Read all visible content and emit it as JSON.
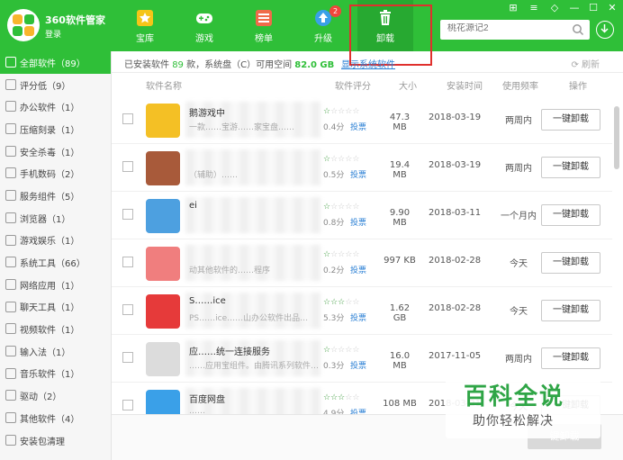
{
  "app": {
    "title": "360软件管家",
    "login": "登录"
  },
  "nav": {
    "tabs": [
      {
        "label": "宝库",
        "icon": "star-icon"
      },
      {
        "label": "游戏",
        "icon": "gamepad-icon"
      },
      {
        "label": "榜单",
        "icon": "ranking-icon"
      },
      {
        "label": "升级",
        "icon": "upgrade-arrow-icon",
        "badge": "2"
      },
      {
        "label": "卸载",
        "icon": "trash-icon"
      }
    ]
  },
  "search": {
    "placeholder": "桃花源记2"
  },
  "sidebar": {
    "items": [
      {
        "label": "全部软件（89）"
      },
      {
        "label": "评分低（9）"
      },
      {
        "label": "办公软件（1）"
      },
      {
        "label": "压缩刻录（1）"
      },
      {
        "label": "安全杀毒（1）"
      },
      {
        "label": "手机数码（2）"
      },
      {
        "label": "服务组件（5）"
      },
      {
        "label": "浏览器（1）"
      },
      {
        "label": "游戏娱乐（1）"
      },
      {
        "label": "系统工具（66）"
      },
      {
        "label": "网络应用（1）"
      },
      {
        "label": "聊天工具（1）"
      },
      {
        "label": "视频软件（1）"
      },
      {
        "label": "输入法（1）"
      },
      {
        "label": "音乐软件（1）"
      },
      {
        "label": "驱动（2）"
      },
      {
        "label": "其他软件（4）"
      },
      {
        "label": "安装包清理"
      }
    ]
  },
  "info": {
    "prefix": "已安装软件",
    "count": "89",
    "middle": "款，系统盘（C）可用空间",
    "free": "82.0 GB",
    "show_system": "显示系统软件",
    "refresh": "刷新"
  },
  "columns": {
    "name": "软件名称",
    "rating": "软件评分",
    "size": "大小",
    "install_time": "安装时间",
    "frequency": "使用频率",
    "action": "操作"
  },
  "rows": [
    {
      "name": "鹅游戏中",
      "desc": "一款……宝游……家宝盘……",
      "stars": 1,
      "score": "0.4分",
      "vote": "投票",
      "size": "47.3 MB",
      "date": "2018-03-19",
      "freq": "两周内",
      "btn": "一键卸载",
      "color": "#f4c025"
    },
    {
      "name": "",
      "desc": "（辅助）……",
      "stars": 1,
      "score": "0.5分",
      "vote": "投票",
      "size": "19.4 MB",
      "date": "2018-03-19",
      "freq": "两周内",
      "btn": "一键卸载",
      "color": "#a85a3a"
    },
    {
      "name": "ei",
      "desc": "",
      "stars": 1,
      "score": "0.8分",
      "vote": "投票",
      "size": "9.90 MB",
      "date": "2018-03-11",
      "freq": "一个月内",
      "btn": "一键卸载",
      "color": "#4da0e0"
    },
    {
      "name": "",
      "desc": "动其他软件的……程序",
      "stars": 1,
      "score": "0.2分",
      "vote": "投票",
      "size": "997 KB",
      "date": "2018-02-28",
      "freq": "今天",
      "btn": "一键卸载",
      "color": "#f07e7e"
    },
    {
      "name": "S……ice",
      "desc": "PS……ice……山办公软件出品…",
      "stars": 3,
      "score": "5.3分",
      "vote": "投票",
      "size": "1.62 GB",
      "date": "2018-02-28",
      "freq": "今天",
      "btn": "一键卸载",
      "color": "#e63a3a"
    },
    {
      "name": "应……统一连接服务",
      "desc": "……应用宝组件。由腾讯系列软件…",
      "stars": 1,
      "score": "0.3分",
      "vote": "投票",
      "size": "16.0 MB",
      "date": "2017-11-05",
      "freq": "两周内",
      "btn": "一键卸载",
      "color": "#dcdcdc"
    },
    {
      "name": "百度网盘",
      "desc": "……",
      "stars": 3,
      "score": "4.9分",
      "vote": "投票",
      "size": "108 MB",
      "date": "2018-03-21",
      "freq": "今天",
      "btn": "一键卸载",
      "color": "#3aa0e8"
    }
  ],
  "footer": {
    "batch": "键卸载"
  },
  "watermark": {
    "big": "百科全说",
    "small": "助你轻松解决"
  },
  "colors": {
    "brand": "#2fbf38",
    "link": "#2a7fd4",
    "highlight": "#e0302d"
  }
}
